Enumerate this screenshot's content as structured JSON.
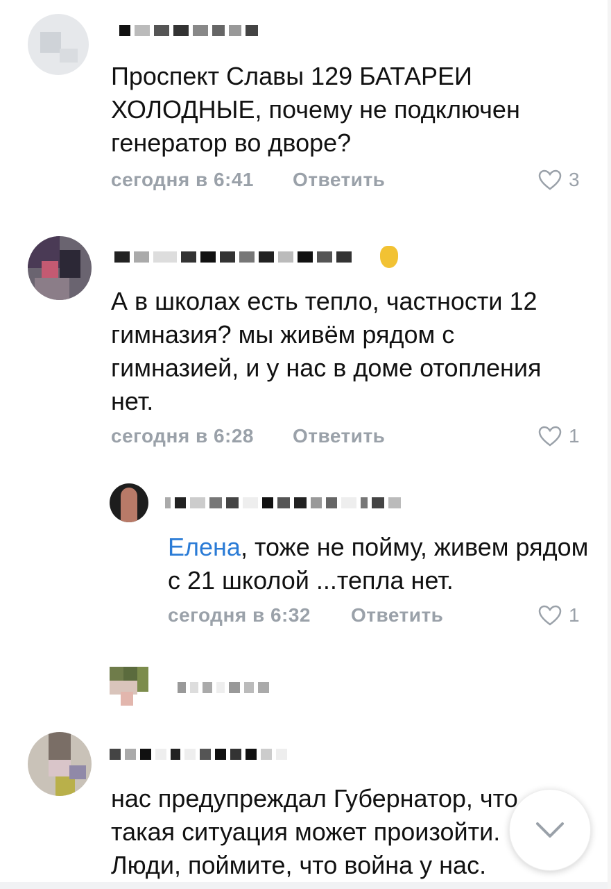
{
  "comments": [
    {
      "text": "Проспект Славы 129 БАТАРЕИ ХОЛОДНЫЕ, почему не подключен генератор во дворе?",
      "time": "сегодня в 6:41",
      "reply_label": "Ответить",
      "likes": "3"
    },
    {
      "text": "А в школах есть тепло,  частности 12 гимназия? мы живём рядом с гимназией, и у нас в доме отопления нет.",
      "time": "сегодня в 6:28",
      "reply_label": "Ответить",
      "likes": "1"
    },
    {
      "mention": "Елена",
      "text": ", тоже не пойму, живем рядом с 21 школой ...тепла нет.",
      "time": "сегодня в 6:32",
      "reply_label": "Ответить",
      "likes": "1"
    },
    {
      "text": "нас предупреждал Губернатор, что такая ситуация может произойти. Люди, поймите, что война у нас."
    }
  ],
  "colors": {
    "mention": "#2a7bd6",
    "meta": "#9aa1a9"
  },
  "icons": {
    "like": "heart-outline-icon",
    "scroll": "chevron-down-icon"
  }
}
